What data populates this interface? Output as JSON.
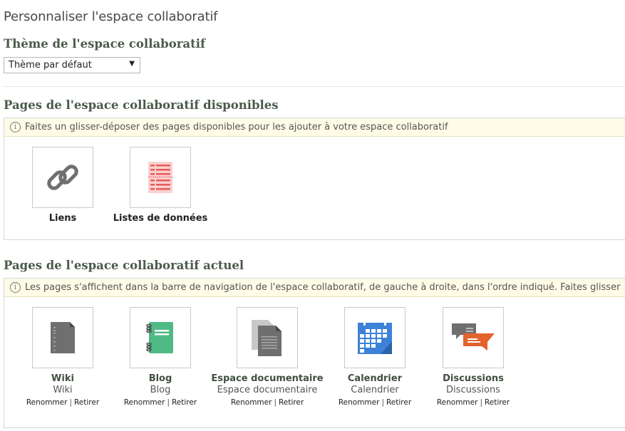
{
  "page_title": "Personnaliser l'espace collaboratif",
  "theme_section": {
    "heading": "Thème de l'espace collaboratif",
    "select_value": "Thème par défaut"
  },
  "available_section": {
    "heading": "Pages de l'espace collaboratif disponibles",
    "info": "Faites un glisser-déposer des pages disponibles pour les ajouter à votre espace collaboratif",
    "tiles": [
      {
        "name": "Liens",
        "icon": "link-icon"
      },
      {
        "name": "Listes de données",
        "icon": "data-list-icon"
      }
    ]
  },
  "current_section": {
    "heading": "Pages de l'espace collaboratif actuel",
    "info": "Les pages s'affichent dans la barre de navigation de l'espace collaboratif, de gauche à droite, dans l'ordre indiqué. Faites glisser",
    "rename_label": "Renommer",
    "remove_label": "Retirer",
    "separator": "|",
    "tiles": [
      {
        "name": "Wiki",
        "subtitle": "Wiki",
        "icon": "wiki-icon"
      },
      {
        "name": "Blog",
        "subtitle": "Blog",
        "icon": "blog-icon"
      },
      {
        "name": "Espace documentaire",
        "subtitle": "Espace documentaire",
        "icon": "document-library-icon"
      },
      {
        "name": "Calendrier",
        "subtitle": "Calendrier",
        "icon": "calendar-icon"
      },
      {
        "name": "Discussions",
        "subtitle": "Discussions",
        "icon": "discussions-icon"
      }
    ]
  },
  "colors": {
    "heading": "#4a5a4a",
    "info_bg": "#fefbe6",
    "blog_green": "#4fba85",
    "calendar_blue": "#3d82d8",
    "discussion_orange": "#e2632b",
    "datalist_red": "#e85a5a"
  }
}
